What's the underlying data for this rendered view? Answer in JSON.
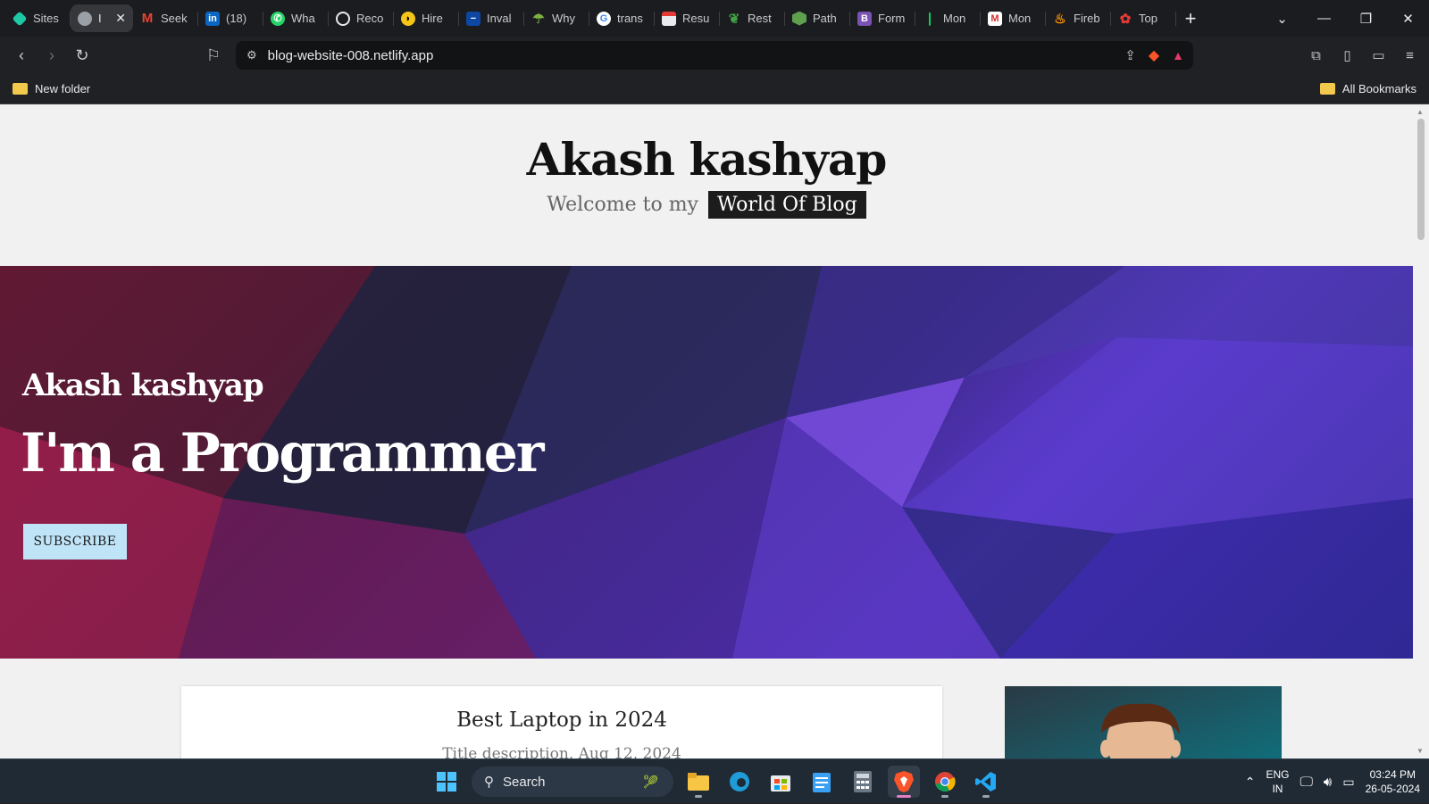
{
  "browser": {
    "tabs": [
      {
        "label": "Sites",
        "icon": "diamond-icon",
        "color": "#1ec8a5"
      },
      {
        "label": "I",
        "icon": "globe-icon",
        "color": "#9aa0a6",
        "active": true
      },
      {
        "label": "Seek",
        "icon": "gmail-icon",
        "color": "#ea4335"
      },
      {
        "label": "(18)",
        "icon": "linkedin-icon",
        "color": "#0a66c2"
      },
      {
        "label": "Wha",
        "icon": "whatsapp-icon",
        "color": "#25d366"
      },
      {
        "label": "Reco",
        "icon": "openai-icon",
        "color": "#e8eaed"
      },
      {
        "label": "Hire",
        "icon": "hire-icon",
        "color": "#f5c518"
      },
      {
        "label": "Inval",
        "icon": "minus-icon",
        "color": "#1e88e5"
      },
      {
        "label": "Why",
        "icon": "umbrella-icon",
        "color": "#7cb342"
      },
      {
        "label": "trans",
        "icon": "google-icon",
        "color": "#4285f4"
      },
      {
        "label": "Resu",
        "icon": "resume-icon",
        "color": "#e53935"
      },
      {
        "label": "Rest",
        "icon": "leaf-icon",
        "color": "#43a047"
      },
      {
        "label": "Path",
        "icon": "node-icon",
        "color": "#5fa04e"
      },
      {
        "label": "Form",
        "icon": "bootstrap-icon",
        "color": "#7952b3"
      },
      {
        "label": "Mon",
        "icon": "mongodb-icon",
        "color": "#00ed64"
      },
      {
        "label": "Mon",
        "icon": "m-icon",
        "color": "#d32f2f"
      },
      {
        "label": "Fireb",
        "icon": "firebase-icon",
        "color": "#ff9100"
      },
      {
        "label": "Top",
        "icon": "top-icon",
        "color": "#e53935"
      }
    ],
    "url": "blog-website-008.netlify.app",
    "bookmark_folder": "New folder",
    "all_bookmarks": "All Bookmarks"
  },
  "page": {
    "site_title": "Akash kashyap",
    "subtitle_prefix": "Welcome to my",
    "subtitle_tag": "World Of Blog",
    "hero": {
      "name": "Akash kashyap",
      "tagline": "I'm  a Programmer",
      "button": "SUBSCRIBE"
    },
    "post": {
      "title": "Best Laptop in 2024",
      "description": "Title description, Aug 12, 2024"
    }
  },
  "taskbar": {
    "search_label": "Search",
    "lang_top": "ENG",
    "lang_bottom": "IN",
    "time": "03:24 PM",
    "date": "26-05-2024"
  }
}
